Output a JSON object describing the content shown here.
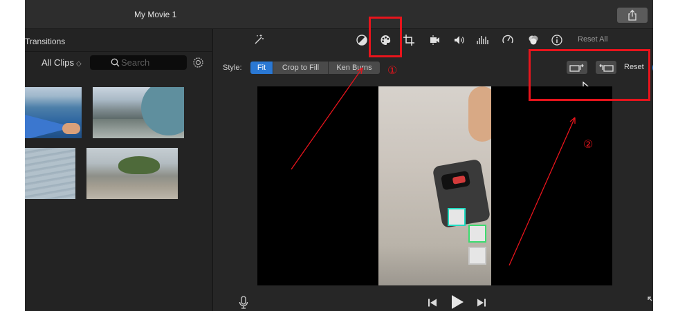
{
  "window": {
    "title": "My Movie 1"
  },
  "browser": {
    "section_title": "Transitions",
    "clips_filter": "All Clips",
    "clips_filter_arrows": "◇",
    "search_placeholder": "Search",
    "thumbnails": [
      "kayak",
      "boat-wake",
      "water",
      "mossy-rock"
    ]
  },
  "toolbar": {
    "tools": [
      "magic-wand",
      "color-balance",
      "color-correction",
      "crop",
      "stabilization",
      "volume",
      "noise-eq",
      "speed",
      "clip-filter",
      "info"
    ],
    "reset_all": "Reset All"
  },
  "crop": {
    "style_label": "Style:",
    "styles": [
      "Fit",
      "Crop to Fill",
      "Ken Burns"
    ],
    "selected_style": "Fit",
    "reset_label": "Reset"
  },
  "annotations": {
    "marker_1": "①",
    "marker_2": "②"
  },
  "colors": {
    "accent": "#2a78d4",
    "annotation": "#e8141c",
    "apply": "#3d8af0"
  }
}
